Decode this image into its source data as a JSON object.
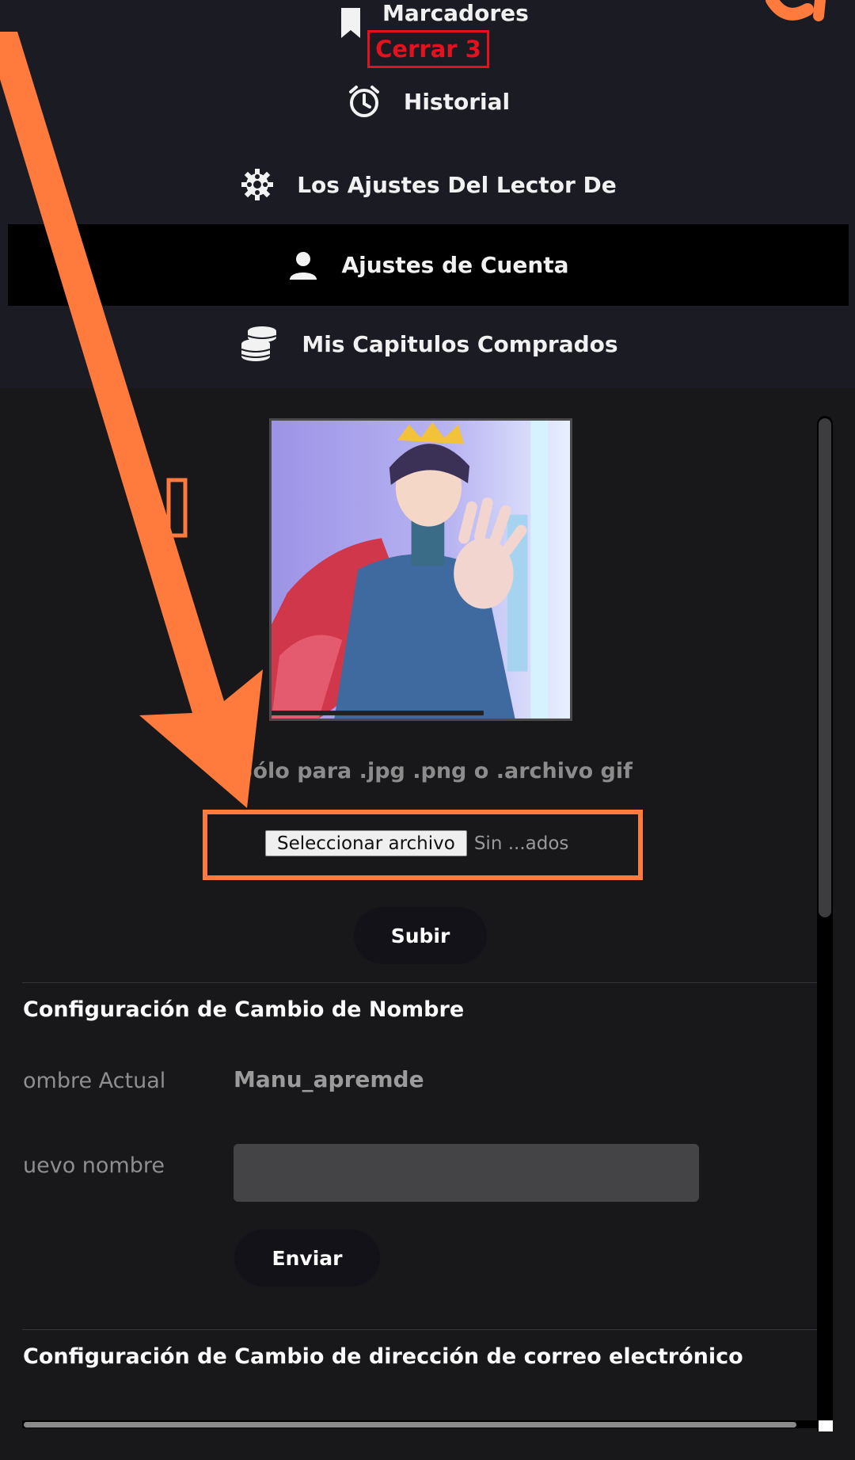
{
  "colors": {
    "background": "#18181b",
    "nav_background": "#1b1b23",
    "active_item": "#000000",
    "close_red": "#e5111e",
    "annotation_orange": "#ff7a3d",
    "input_background": "#444446"
  },
  "nav": {
    "items": [
      {
        "label": "Marcadores",
        "icon": "bookmark-icon"
      },
      {
        "label": "Historial",
        "icon": "alarm-clock-icon"
      },
      {
        "label": "Los Ajustes Del Lector De",
        "icon": "gear-icon"
      },
      {
        "label": "Ajustes de Cuenta",
        "icon": "user-icon",
        "active": true
      },
      {
        "label": "Mis Capitulos Comprados",
        "icon": "coins-stack-icon"
      }
    ],
    "close_label": "Cerrar 3"
  },
  "avatar": {
    "file_hint": "Sólo para .jpg .png o .archivo gif",
    "file_button": "Seleccionar archivo",
    "file_status": "Sin ...ados",
    "upload_button": "Subir"
  },
  "name_change": {
    "title": "Configuración de Cambio de Nombre",
    "current_label": "ombre Actual",
    "current_value": "Manu_apremde",
    "new_label": "uevo nombre",
    "new_value": "",
    "submit_button": "Enviar"
  },
  "email_change": {
    "title": "Configuración de Cambio de dirección de correo electrónico"
  }
}
